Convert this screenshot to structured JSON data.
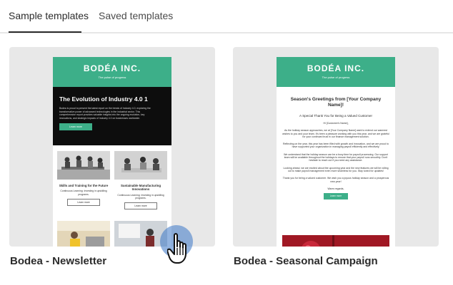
{
  "tabs": [
    {
      "label": "Sample templates",
      "active": true
    },
    {
      "label": "Saved templates",
      "active": false
    }
  ],
  "templates": [
    {
      "name": "Bodea - Newsletter",
      "preview": {
        "brand": "BODÉA INC.",
        "tagline": "The pulse of progress",
        "hero_title": "The Evolution of Industry 4.0 1",
        "hero_body": "Bodea is proud to present the latest report on the trends of Industry 4.0, exploring the transformative power of advanced technologies in the industrial sector. This comprehensive report provides valuable insights into the ongoing evolution, key innovations, and strategic impacts of Industry 4.0 on businesses worldwide.",
        "hero_button": "Learn more",
        "cells": [
          {
            "title": "Skills and Training for the Future",
            "body": "Continuous Learning: Investing in upskilling programs.",
            "button": "Learn more"
          },
          {
            "title": "Sustainable Manufacturing Innovations",
            "body": "Continuous Learning: Investing in upskilling programs.",
            "button": "Learn more"
          }
        ]
      }
    },
    {
      "name": "Bodea - Seasonal Campaign",
      "preview": {
        "brand": "BODÉA INC.",
        "tagline": "The pulse of progress",
        "title": "Season's Greetings from [Your Company Name]!",
        "subtitle": "A Special Thank You for Being a Valued Customer",
        "greeting": "Hi [Customer's Name],",
        "paragraphs": [
          "As the holiday season approaches, we at [Your Company Name] want to extend our warmest wishes to you and your team. It's been a pleasure working with you this year, and we are grateful for your continued trust in our finance management solution.",
          "Reflecting on the year, this year has been filled with growth and innovation, and we are proud to have supported your organization in managing payroll efficiently and effectively.",
          "We understand that the holiday season can be a busy time for payroll processing. Our support team will be available throughout the holidays to ensure that your payroll runs smoothly. Don't hesitate to reach out if you need any assistance.",
          "Looking ahead, we are excited about the upcoming year and the new features we will be rolling out to make payroll management even more seamless for you. Stay tuned for updates!",
          "Thank you for being a valued customer. We wish you a joyous holiday season and a prosperous new year!",
          "Warm regards,"
        ],
        "button": "Learn more"
      }
    }
  ],
  "colors": {
    "brand_green": "#3daf89",
    "hover": "#3a76c7"
  },
  "icons": {
    "cursor": "hand-pointer-icon"
  }
}
